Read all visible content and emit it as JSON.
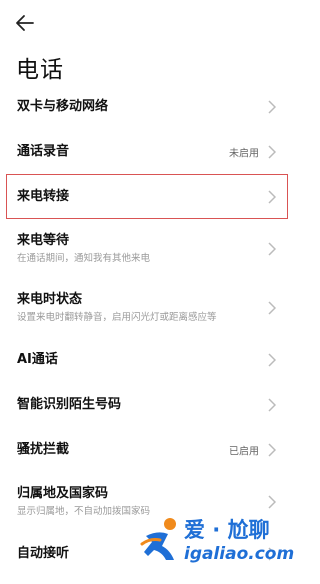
{
  "header": {
    "back_icon": "arrow-left-icon",
    "title": "电话"
  },
  "items": [
    {
      "label": "双卡与移动网络",
      "value": "",
      "sub": ""
    },
    {
      "label": "通话录音",
      "value": "未启用",
      "sub": ""
    },
    {
      "label": "来电转接",
      "value": "",
      "sub": "",
      "highlighted": true
    },
    {
      "label": "来电等待",
      "value": "",
      "sub": "在通话期间，通知我有其他来电"
    },
    {
      "label": "来电时状态",
      "value": "",
      "sub": "设置来电时翻转静音，启用闪光灯或距离感应等"
    },
    {
      "label": "AI通话",
      "value": "",
      "sub": ""
    },
    {
      "label": "智能识别陌生号码",
      "value": "",
      "sub": ""
    },
    {
      "label": "骚扰拦截",
      "value": "",
      "value2": "已启用",
      "sub": ""
    },
    {
      "label": "归属地及国家码",
      "value": "",
      "sub": "显示归属地，不自动加拨国家码"
    },
    {
      "label": "自动接听",
      "value": "",
      "sub": ""
    }
  ],
  "watermark": {
    "cn": "爱 · 尬聊",
    "en": "igaliao.com"
  },
  "colors": {
    "highlight_border": "#d95353",
    "watermark_blue": "#1f6fd6",
    "watermark_orange": "#f08a1c"
  }
}
